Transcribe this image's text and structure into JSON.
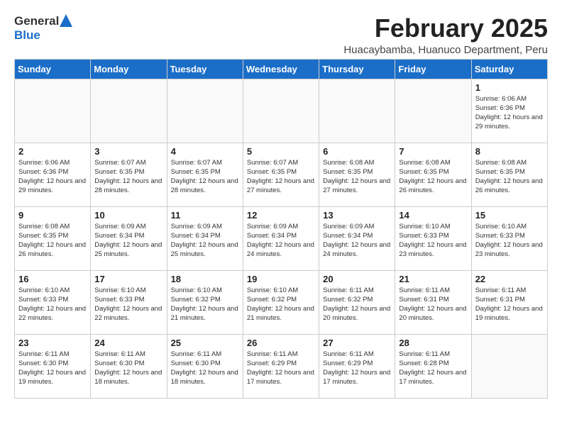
{
  "logo": {
    "general": "General",
    "blue": "Blue"
  },
  "title": "February 2025",
  "subtitle": "Huacaybamba, Huanuco Department, Peru",
  "days_of_week": [
    "Sunday",
    "Monday",
    "Tuesday",
    "Wednesday",
    "Thursday",
    "Friday",
    "Saturday"
  ],
  "weeks": [
    [
      {
        "day": "",
        "info": ""
      },
      {
        "day": "",
        "info": ""
      },
      {
        "day": "",
        "info": ""
      },
      {
        "day": "",
        "info": ""
      },
      {
        "day": "",
        "info": ""
      },
      {
        "day": "",
        "info": ""
      },
      {
        "day": "1",
        "info": "Sunrise: 6:06 AM\nSunset: 6:36 PM\nDaylight: 12 hours and 29 minutes."
      }
    ],
    [
      {
        "day": "2",
        "info": "Sunrise: 6:06 AM\nSunset: 6:36 PM\nDaylight: 12 hours and 29 minutes."
      },
      {
        "day": "3",
        "info": "Sunrise: 6:07 AM\nSunset: 6:35 PM\nDaylight: 12 hours and 28 minutes."
      },
      {
        "day": "4",
        "info": "Sunrise: 6:07 AM\nSunset: 6:35 PM\nDaylight: 12 hours and 28 minutes."
      },
      {
        "day": "5",
        "info": "Sunrise: 6:07 AM\nSunset: 6:35 PM\nDaylight: 12 hours and 27 minutes."
      },
      {
        "day": "6",
        "info": "Sunrise: 6:08 AM\nSunset: 6:35 PM\nDaylight: 12 hours and 27 minutes."
      },
      {
        "day": "7",
        "info": "Sunrise: 6:08 AM\nSunset: 6:35 PM\nDaylight: 12 hours and 26 minutes."
      },
      {
        "day": "8",
        "info": "Sunrise: 6:08 AM\nSunset: 6:35 PM\nDaylight: 12 hours and 26 minutes."
      }
    ],
    [
      {
        "day": "9",
        "info": "Sunrise: 6:08 AM\nSunset: 6:35 PM\nDaylight: 12 hours and 26 minutes."
      },
      {
        "day": "10",
        "info": "Sunrise: 6:09 AM\nSunset: 6:34 PM\nDaylight: 12 hours and 25 minutes."
      },
      {
        "day": "11",
        "info": "Sunrise: 6:09 AM\nSunset: 6:34 PM\nDaylight: 12 hours and 25 minutes."
      },
      {
        "day": "12",
        "info": "Sunrise: 6:09 AM\nSunset: 6:34 PM\nDaylight: 12 hours and 24 minutes."
      },
      {
        "day": "13",
        "info": "Sunrise: 6:09 AM\nSunset: 6:34 PM\nDaylight: 12 hours and 24 minutes."
      },
      {
        "day": "14",
        "info": "Sunrise: 6:10 AM\nSunset: 6:33 PM\nDaylight: 12 hours and 23 minutes."
      },
      {
        "day": "15",
        "info": "Sunrise: 6:10 AM\nSunset: 6:33 PM\nDaylight: 12 hours and 23 minutes."
      }
    ],
    [
      {
        "day": "16",
        "info": "Sunrise: 6:10 AM\nSunset: 6:33 PM\nDaylight: 12 hours and 22 minutes."
      },
      {
        "day": "17",
        "info": "Sunrise: 6:10 AM\nSunset: 6:33 PM\nDaylight: 12 hours and 22 minutes."
      },
      {
        "day": "18",
        "info": "Sunrise: 6:10 AM\nSunset: 6:32 PM\nDaylight: 12 hours and 21 minutes."
      },
      {
        "day": "19",
        "info": "Sunrise: 6:10 AM\nSunset: 6:32 PM\nDaylight: 12 hours and 21 minutes."
      },
      {
        "day": "20",
        "info": "Sunrise: 6:11 AM\nSunset: 6:32 PM\nDaylight: 12 hours and 20 minutes."
      },
      {
        "day": "21",
        "info": "Sunrise: 6:11 AM\nSunset: 6:31 PM\nDaylight: 12 hours and 20 minutes."
      },
      {
        "day": "22",
        "info": "Sunrise: 6:11 AM\nSunset: 6:31 PM\nDaylight: 12 hours and 19 minutes."
      }
    ],
    [
      {
        "day": "23",
        "info": "Sunrise: 6:11 AM\nSunset: 6:30 PM\nDaylight: 12 hours and 19 minutes."
      },
      {
        "day": "24",
        "info": "Sunrise: 6:11 AM\nSunset: 6:30 PM\nDaylight: 12 hours and 18 minutes."
      },
      {
        "day": "25",
        "info": "Sunrise: 6:11 AM\nSunset: 6:30 PM\nDaylight: 12 hours and 18 minutes."
      },
      {
        "day": "26",
        "info": "Sunrise: 6:11 AM\nSunset: 6:29 PM\nDaylight: 12 hours and 17 minutes."
      },
      {
        "day": "27",
        "info": "Sunrise: 6:11 AM\nSunset: 6:29 PM\nDaylight: 12 hours and 17 minutes."
      },
      {
        "day": "28",
        "info": "Sunrise: 6:11 AM\nSunset: 6:28 PM\nDaylight: 12 hours and 17 minutes."
      },
      {
        "day": "",
        "info": ""
      }
    ]
  ]
}
